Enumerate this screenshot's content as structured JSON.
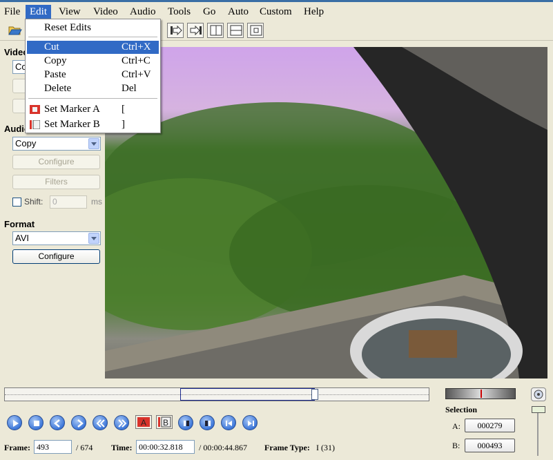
{
  "menubar": {
    "items": [
      "File",
      "Edit",
      "View",
      "Video",
      "Audio",
      "Tools",
      "Go",
      "Auto",
      "Custom",
      "Help"
    ]
  },
  "edit_menu": {
    "reset": "Reset Edits",
    "cut": {
      "label": "Cut",
      "shortcut": "Ctrl+X"
    },
    "copy": {
      "label": "Copy",
      "shortcut": "Ctrl+C"
    },
    "paste": {
      "label": "Paste",
      "shortcut": "Ctrl+V"
    },
    "delete": {
      "label": "Delete",
      "shortcut": "Del"
    },
    "marker_a": {
      "label": "Set Marker A",
      "shortcut": "["
    },
    "marker_b": {
      "label": "Set Marker B",
      "shortcut": "]"
    }
  },
  "video_section": {
    "title": "Video",
    "codec_value": "Copy"
  },
  "audio_section": {
    "title": "Audio",
    "codec_value": "Copy",
    "configure": "Configure",
    "filters": "Filters",
    "shift_label": "Shift:",
    "shift_value": "0",
    "shift_unit": "ms"
  },
  "format_section": {
    "title": "Format",
    "value": "AVI",
    "configure": "Configure"
  },
  "status": {
    "frame_label": "Frame:",
    "frame_value": "493",
    "frame_total": "/ 674",
    "time_label": "Time:",
    "time_value": "00:00:32.818",
    "time_total": "/ 00:00:44.867",
    "frame_type_label": "Frame Type:",
    "frame_type_value": "I (31)"
  },
  "selection": {
    "title": "Selection",
    "a_label": "A:",
    "a_value": "000279",
    "b_label": "B:",
    "b_value": "000493"
  },
  "markers": {
    "a_glyph": "A",
    "b_glyph": "B"
  },
  "timeline": {
    "position_fraction": 0.731,
    "selection_start_fraction": 0.414,
    "selection_end_fraction": 0.731
  },
  "icons": {
    "open": "folder-open-icon",
    "nav": [
      "play-icon",
      "stop-icon",
      "previous-frame-icon",
      "next-frame-icon",
      "previous-keyframe-icon",
      "next-keyframe-icon",
      "set-marker-a-icon",
      "set-marker-b-icon",
      "go-marker-a-icon",
      "go-marker-b-icon",
      "go-start-icon",
      "go-end-icon"
    ]
  }
}
